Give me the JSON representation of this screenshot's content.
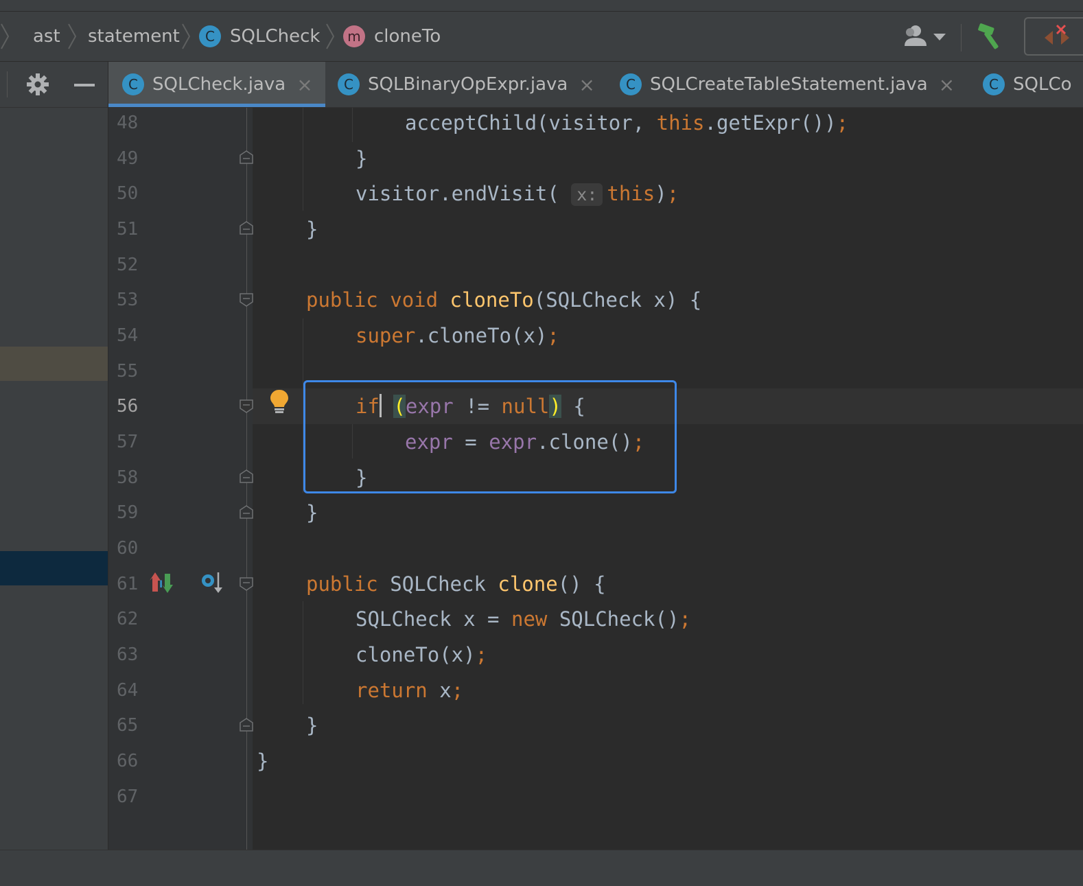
{
  "breadcrumbs": [
    {
      "label": "ast",
      "icon": null
    },
    {
      "label": "statement",
      "icon": null
    },
    {
      "label": "SQLCheck",
      "icon": "class-icon"
    },
    {
      "label": "cloneTo",
      "icon": "method-icon"
    }
  ],
  "tabs": [
    {
      "label": "SQLCheck.java",
      "active": true
    },
    {
      "label": "SQLBinaryOpExpr.java",
      "active": false
    },
    {
      "label": "SQLCreateTableStatement.java",
      "active": false
    },
    {
      "label": "SQLCo",
      "active": false
    }
  ],
  "badges": {
    "class": "C",
    "method": "m"
  },
  "close_glyph": "×",
  "editor": {
    "current_line": 56,
    "line_numbers": [
      "48",
      "49",
      "50",
      "51",
      "52",
      "53",
      "54",
      "55",
      "56",
      "57",
      "58",
      "59",
      "60",
      "61",
      "62",
      "63",
      "64",
      "65",
      "66",
      "67"
    ],
    "code": {
      "l48": {
        "a": "acceptChild(visitor, ",
        "b": "this",
        "c": ".getExpr())",
        "d": ";"
      },
      "l49": "}",
      "l50": {
        "a": "visitor.endVisit( ",
        "hint": "x:",
        "b": "this",
        "c": ")",
        "d": ";"
      },
      "l51": "}",
      "l53": {
        "kw1": "public",
        "kw2": "void",
        "fn": "cloneTo",
        "rest": "(SQLCheck x) {"
      },
      "l54": {
        "kw": "super",
        "rest": ".cloneTo(x)",
        "semi": ";"
      },
      "l56": {
        "kw": "if",
        "open": "(",
        "fld": "expr",
        "op": " != ",
        "kw2": "null",
        "close": ")",
        "rest": " {"
      },
      "l57": {
        "fld1": "expr",
        "op": " = ",
        "fld2": "expr",
        "rest": ".clone()",
        "semi": ";"
      },
      "l58": "}",
      "l59": "}",
      "l61": {
        "kw": "public",
        "type": "SQLCheck",
        "fn": "clone",
        "rest": "() {"
      },
      "l62": {
        "a": "SQLCheck x = ",
        "kw": "new",
        "b": " SQLCheck()",
        "semi": ";"
      },
      "l63": {
        "a": "cloneTo(x)",
        "semi": ";"
      },
      "l64": {
        "kw": "return",
        "a": " x",
        "semi": ";"
      },
      "l65": "}",
      "l66": "}"
    }
  },
  "colors": {
    "keyword": "#cc7832",
    "function": "#ffc66d",
    "field": "#9876aa",
    "text": "#a9b7c6",
    "selection_box": "#3e88e8",
    "tab_underline": "#4a88c7"
  }
}
